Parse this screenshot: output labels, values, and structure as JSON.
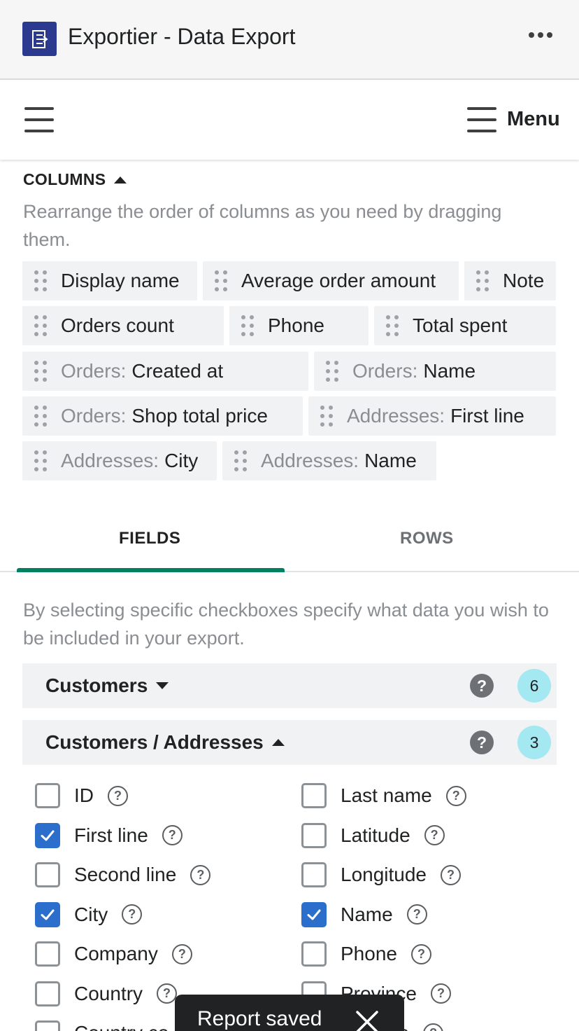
{
  "app": {
    "title": "Exportier - Data Export"
  },
  "navbar": {
    "menu_label": "Menu"
  },
  "columns": {
    "heading": "COLUMNS",
    "description": "Rearrange the order of columns as you need by dragging them.",
    "chips": [
      {
        "prefix": "",
        "label": "Display name"
      },
      {
        "prefix": "",
        "label": "Average order amount"
      },
      {
        "prefix": "",
        "label": "Note"
      },
      {
        "prefix": "",
        "label": "Orders count"
      },
      {
        "prefix": "",
        "label": "Phone"
      },
      {
        "prefix": "",
        "label": "Total spent"
      },
      {
        "prefix": "Orders:",
        "label": "Created at"
      },
      {
        "prefix": "Orders:",
        "label": "Name"
      },
      {
        "prefix": "Orders:",
        "label": "Shop total price"
      },
      {
        "prefix": "Addresses:",
        "label": "First line"
      },
      {
        "prefix": "Addresses:",
        "label": "City"
      },
      {
        "prefix": "Addresses:",
        "label": "Name"
      }
    ]
  },
  "tabs": {
    "fields": "FIELDS",
    "rows": "ROWS",
    "active": "FIELDS"
  },
  "fields": {
    "description": "By selecting specific checkboxes specify what data you wish to be included in your export.",
    "sections": [
      {
        "title": "Customers",
        "help": "?",
        "count": "6",
        "expanded": false
      },
      {
        "title": "Customers / Addresses",
        "help": "?",
        "count": "3",
        "expanded": true
      }
    ],
    "address_fields_left": [
      {
        "label": "ID",
        "checked": false
      },
      {
        "label": "First line",
        "checked": true
      },
      {
        "label": "Second line",
        "checked": false
      },
      {
        "label": "City",
        "checked": true
      },
      {
        "label": "Company",
        "checked": false
      },
      {
        "label": "Country",
        "checked": false
      },
      {
        "label": "Country co",
        "checked": false
      }
    ],
    "address_fields_right": [
      {
        "label": "Last name",
        "checked": false
      },
      {
        "label": "Latitude",
        "checked": false
      },
      {
        "label": "Longitude",
        "checked": false
      },
      {
        "label": "Name",
        "checked": true
      },
      {
        "label": "Phone",
        "checked": false
      },
      {
        "label": "Province",
        "checked": false
      },
      {
        "label": "ce code",
        "checked": false
      }
    ]
  },
  "toast": {
    "message": "Report saved"
  },
  "colors": {
    "accent": "#008060",
    "checkbox_checked": "#2c6ecb",
    "badge": "#a4e8f2",
    "logo": "#2b3a8f"
  },
  "icons": [
    "app-logo-icon",
    "more-icon",
    "hamburger-icon",
    "drag-handle-icon",
    "help-icon",
    "check-icon",
    "close-icon"
  ]
}
